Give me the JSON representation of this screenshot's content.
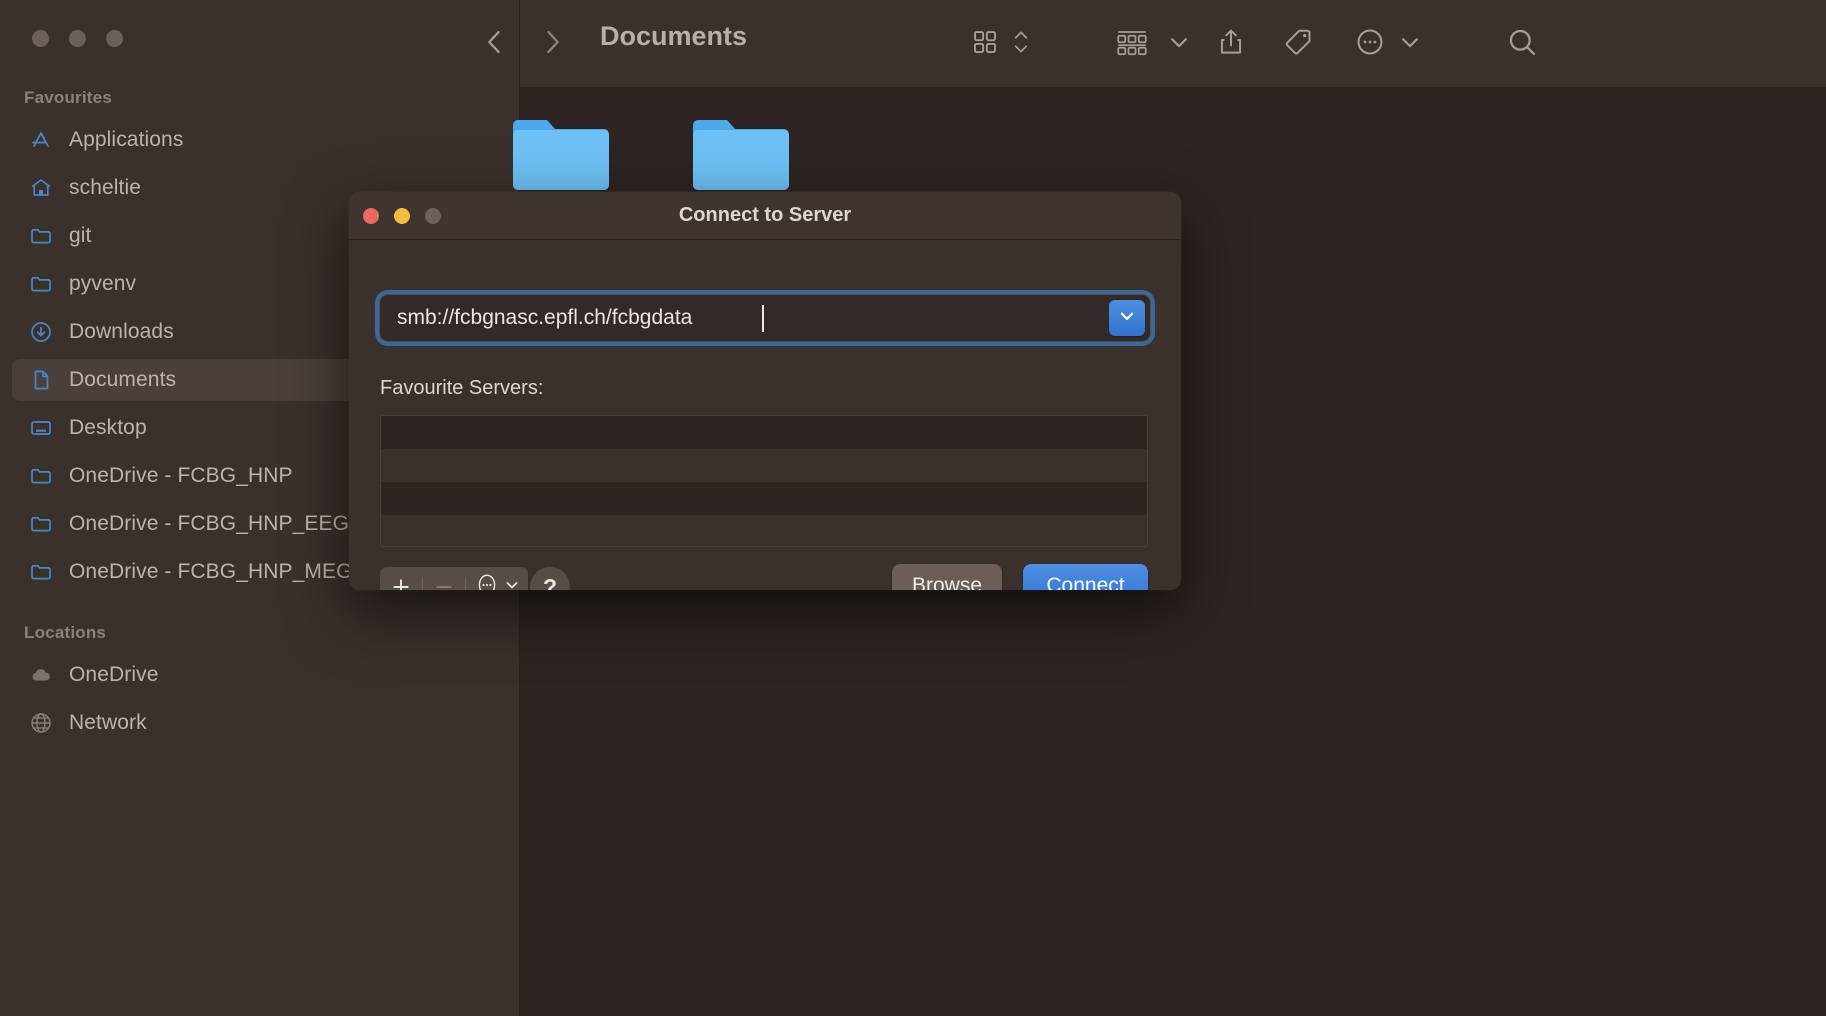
{
  "window": {
    "traffic_lights": [
      "close",
      "minimize",
      "zoom"
    ],
    "toolbar": {
      "back_icon": "chevron-left-icon",
      "forward_icon": "chevron-right-icon",
      "title": "Documents",
      "view_icon": "grid-view-icon",
      "view_stepper_icon": "chevron-up-down-icon",
      "group_icon": "group-by-icon",
      "group_chevron_icon": "chevron-down-icon",
      "share_icon": "share-icon",
      "tag_icon": "tag-icon",
      "more_icon": "ellipsis-circle-icon",
      "more_chevron_icon": "chevron-down-icon",
      "search_icon": "search-icon"
    },
    "files": [
      {
        "name": "folder",
        "icon": "folder-icon"
      },
      {
        "name": "folder",
        "icon": "folder-icon"
      }
    ]
  },
  "sidebar": {
    "sections": [
      {
        "title": "Favourites",
        "items": [
          {
            "label": "Applications",
            "icon": "applications-icon",
            "selected": false
          },
          {
            "label": "scheltie",
            "icon": "home-icon",
            "selected": false
          },
          {
            "label": "git",
            "icon": "folder-icon",
            "selected": false
          },
          {
            "label": "pyvenv",
            "icon": "folder-icon",
            "selected": false
          },
          {
            "label": "Downloads",
            "icon": "downloads-icon",
            "selected": false
          },
          {
            "label": "Documents",
            "icon": "document-icon",
            "selected": true
          },
          {
            "label": "Desktop",
            "icon": "desktop-icon",
            "selected": false
          },
          {
            "label": "OneDrive - FCBG_HNP",
            "icon": "folder-icon",
            "selected": false
          },
          {
            "label": "OneDrive - FCBG_HNP_EEG",
            "icon": "folder-icon",
            "selected": false
          },
          {
            "label": "OneDrive - FCBG_HNP_MEG",
            "icon": "folder-icon",
            "selected": false
          }
        ]
      },
      {
        "title": "Locations",
        "items": [
          {
            "label": "OneDrive",
            "icon": "cloud-icon",
            "selected": false
          },
          {
            "label": "Network",
            "icon": "globe-icon",
            "selected": false
          }
        ]
      }
    ]
  },
  "dialog": {
    "title": "Connect to Server",
    "traffic_lights": [
      "close",
      "minimize",
      "zoom"
    ],
    "server_url": "smb://fcbgnasc.epfl.ch/fcbgdata",
    "server_url_placeholder": "smb://",
    "dropdown_icon": "chevron-down-icon",
    "favourites_label": "Favourite Servers:",
    "favourites": [],
    "favourites_row_count": 4,
    "add_label": "+",
    "remove_label": "−",
    "more_icon": "ellipsis-circle-icon",
    "more_chevron_icon": "chevron-down-icon",
    "help_label": "?",
    "browse_label": "Browse",
    "connect_label": "Connect"
  },
  "colors": {
    "window_bg": "#362c28",
    "sidebar_bg": "#3a302c",
    "canvas_bg": "#2e2522",
    "accent_blue": "#3f7fd6",
    "sidebar_icon_blue": "#4a87c8",
    "folder_blue": "#64b5f0",
    "text_primary": "#ded6d2",
    "text_secondary": "#bdb3ae",
    "text_muted": "#8d817c",
    "tl_close": "#e8695e",
    "tl_min": "#f3bb40",
    "tl_zoom": "#6b605c"
  }
}
